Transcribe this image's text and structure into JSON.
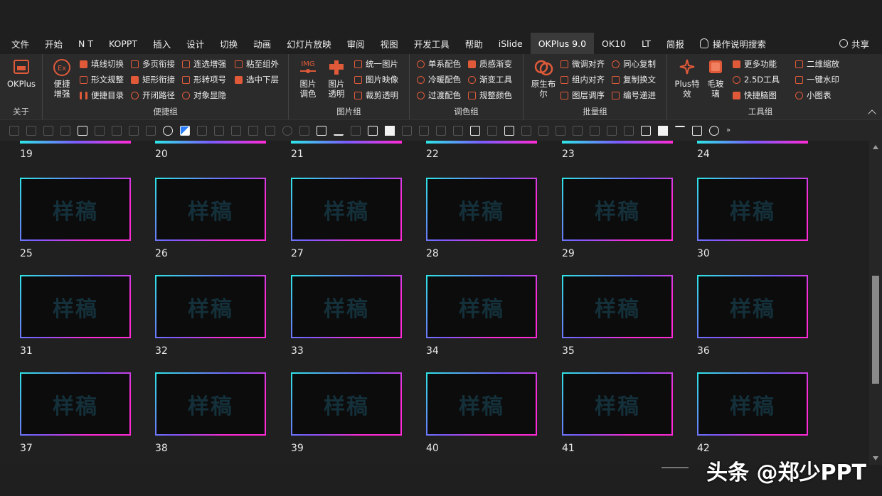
{
  "menu": {
    "tabs": [
      "文件",
      "开始",
      "N T",
      "KOPPT",
      "插入",
      "设计",
      "切换",
      "动画",
      "幻灯片放映",
      "审阅",
      "视图",
      "开发工具",
      "帮助",
      "iSlide",
      "OKPlus 9.0",
      "OK10",
      "LT",
      "简报"
    ],
    "active_tab": "OKPlus 9.0",
    "search_label": "操作说明搜索",
    "share_label": "共享"
  },
  "ribbon": {
    "about": {
      "button": "OKPlus",
      "label": "关于"
    },
    "shortcut": {
      "label": "便捷组",
      "big": "便捷增强",
      "col1": [
        "填线切换",
        "形文规整",
        "便捷目录"
      ],
      "col2": [
        "多页衔接",
        "矩形衔接",
        "开闭路径"
      ],
      "col3": [
        "连选增强",
        "形转项号",
        "对象显隐"
      ],
      "col4": [
        "粘至组外",
        "选中下层"
      ]
    },
    "picture": {
      "label": "图片组",
      "big1": "图片调色",
      "big1_badge": "IMG",
      "big2": "图片透明",
      "col": [
        "统一图片",
        "图片映像",
        "裁剪透明"
      ]
    },
    "color": {
      "label": "调色组",
      "col1": [
        "单系配色",
        "冷暖配色",
        "过渡配色"
      ],
      "col2": [
        "质感渐变",
        "渐变工具",
        "规整颜色"
      ]
    },
    "batch": {
      "label": "批量组",
      "big": "原生布尔",
      "col1": [
        "微调对齐",
        "组内对齐",
        "图层调序"
      ],
      "col2": [
        "同心复制",
        "复制换文",
        "编号递进"
      ]
    },
    "tools": {
      "label": "工具组",
      "big1": "Plus特效",
      "big2": "毛玻璃",
      "col1": [
        "更多功能",
        "2.5D工具",
        "快捷脑图"
      ],
      "col2": [
        "二维缩放",
        "一键水印",
        "小图表"
      ]
    }
  },
  "slides": {
    "watermark": "样稿",
    "top_partial_numbers": [
      "19",
      "20",
      "21",
      "22",
      "23",
      "24"
    ],
    "rows": [
      [
        "25",
        "26",
        "27",
        "28",
        "29",
        "30"
      ],
      [
        "31",
        "32",
        "33",
        "34",
        "35",
        "36"
      ],
      [
        "37",
        "38",
        "39",
        "40",
        "41",
        "42"
      ]
    ]
  },
  "brand_watermark": "头条 @郑少PPT",
  "colors": {
    "accent": "#e05a3a",
    "slide_border_start": "#2ee6e6",
    "slide_border_end": "#ff2bd6",
    "background": "#202020"
  }
}
